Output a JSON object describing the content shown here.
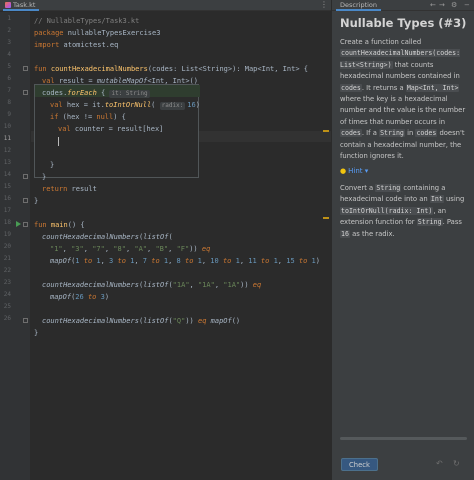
{
  "editor": {
    "tab_label": "Task.kt",
    "line_numbers": [
      "1",
      "2",
      "3",
      "4",
      "5",
      "6",
      "7",
      "8",
      "9",
      "10",
      "11",
      "12",
      "13",
      "14",
      "15",
      "16",
      "17",
      "18",
      "19",
      "20",
      "21",
      "22",
      "23",
      "24",
      "25",
      "26"
    ],
    "current_line": "11",
    "lines": {
      "l1": "// NullableTypes/Task3.kt",
      "l2_kw": "package",
      "l2_rest": " nullableTypesExercise3",
      "l3_kw": "import",
      "l3_rest": " atomictest.eq",
      "l5_kw": "fun",
      "l5_fn": " countHexadecimalNumbers",
      "l5_rest": "(codes: List<String>): Map<Int, Int> {",
      "l6_kw": "val",
      "l6_a": " result = ",
      "l6_fn": "mutableMapOf",
      "l6_b": "<Int, Int>()",
      "l7_a": "codes.",
      "l7_fn": "forEach",
      "l7_b": " { ",
      "l7_hint": "it: String",
      "l8_kw": "val",
      "l8_a": " hex = it.",
      "l8_fn": "toIntOrNull",
      "l8_b": "( ",
      "l8_hint": "radix:",
      "l8_n": "16",
      "l8_c": ")",
      "l9_kw": "if",
      "l9_a": " (hex != ",
      "l9_kw2": "null",
      "l9_b": ") {",
      "l10_kw": "val",
      "l10_a": " counter = result[hex]",
      "l13_a": "}",
      "l14_a": "}",
      "l15_kw": "return",
      "l15_a": " result",
      "l16_a": "}",
      "l18_kw": "fun",
      "l18_fn": " main",
      "l18_a": "() {",
      "l19_fn": "countHexadecimalNumbers",
      "l19_a": "(",
      "l19_fn2": "listOf",
      "l19_b": "(",
      "l20_s1": "\"1\"",
      "l20_s2": "\"3\"",
      "l20_s3": "\"7\"",
      "l20_s4": "\"8\"",
      "l20_s5": "\"A\"",
      "l20_s6": "\"B\"",
      "l20_s7": "\"F\"",
      "l20_kw": "eq",
      "l21_fn": "mapOf",
      "l21_n1": "1",
      "l21_w1": "to",
      "l21_n2": "1",
      "l21_n3": "3",
      "l21_w2": "to",
      "l21_n4": "1",
      "l21_n5": "7",
      "l21_w3": "to",
      "l21_n6": "1",
      "l21_n7": "8",
      "l21_w4": "to",
      "l21_n8": "1",
      "l21_n9": "10",
      "l21_w5": "to",
      "l21_n10": "1",
      "l21_n11": "11",
      "l21_w6": "to",
      "l21_n12": "1",
      "l21_n13": "15",
      "l21_w7": "to",
      "l21_n14": "1",
      "l23_fn": "countHexadecimalNumbers",
      "l23_fn2": "listOf",
      "l23_s1": "\"1A\"",
      "l23_s2": "\"1A\"",
      "l23_s3": "\"1A\"",
      "l23_kw": "eq",
      "l24_fn": "mapOf",
      "l24_n1": "26",
      "l24_w": "to",
      "l24_n2": "3",
      "l26_fn": "countHexadecimalNumbers",
      "l26_fn2": "listOf",
      "l26_s1": "\"Q\"",
      "l26_kw": "eq",
      "l26_fn3": "mapOf",
      "l27_a": "}"
    }
  },
  "description": {
    "tab_label": "Description",
    "title": "Nullable Types (#3)",
    "p1": {
      "t1": "Create a function called ",
      "c1": "countHexadecimalNumbers(codes: List<String>)",
      "t2": " that counts hexadecimal numbers contained in ",
      "c2": "codes",
      "t3": ". It returns a ",
      "c3": "Map<Int, Int>",
      "t4": " where the key is a hexadecimal number and the value is the number of times that number occurs in ",
      "c4": "codes",
      "t5": ". If a ",
      "c5": "String",
      "t6": " in ",
      "c6": "codes",
      "t7": " doesn't contain a hexadecimal number, the function ignores it."
    },
    "hint_label": "Hint",
    "p2": {
      "t1": "Convert a ",
      "c1": "String",
      "t2": " containing a hexadecimal code into an ",
      "c2": "Int",
      "t3": " using ",
      "c3": "toIntOrNull(radix: Int)",
      "t4": ", an extension function for ",
      "c4": "String",
      "t5": ". Pass ",
      "c5": "16",
      "t6": " as the radix."
    },
    "check_label": "Check"
  },
  "icons": {
    "tab_menu": "more-vertical-icon",
    "prev": "arrow-left-icon",
    "next": "arrow-right-icon",
    "settings": "gear-icon",
    "hide": "minus-icon",
    "reset": "undo-icon",
    "bulb": "lightbulb-icon"
  },
  "colors": {
    "keyword": "#cc7832",
    "string": "#6a8759",
    "number": "#6897bb",
    "function": "#ffc66d",
    "accent": "#4a88c7",
    "check_button": "#365880"
  }
}
